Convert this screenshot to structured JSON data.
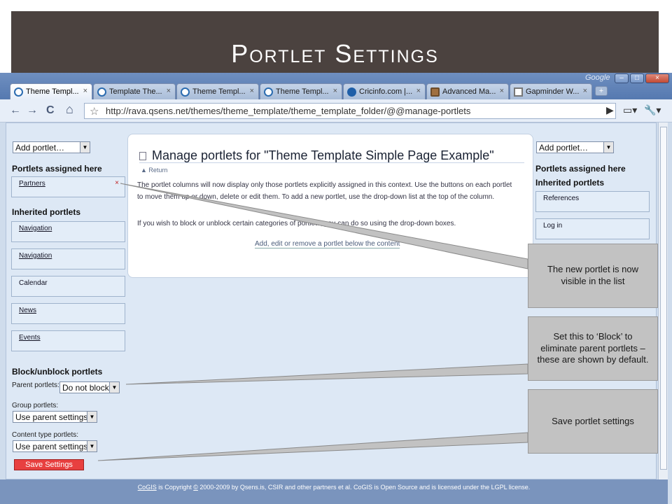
{
  "slide": {
    "title": "Portlet Settings"
  },
  "browser": {
    "google_label": "Google",
    "window_controls": {
      "minimize": "–",
      "maximize": "□",
      "close": "×"
    },
    "tabs": [
      {
        "label": "Theme Templ...",
        "close": "×",
        "icon": "site-icon",
        "active": true
      },
      {
        "label": "Template The...",
        "close": "×",
        "icon": "site-icon",
        "active": false
      },
      {
        "label": "Theme Templ...",
        "close": "×",
        "icon": "site-icon",
        "active": false
      },
      {
        "label": "Theme Templ...",
        "close": "×",
        "icon": "site-icon",
        "active": false
      },
      {
        "label": "Cricinfo.com |...",
        "close": "×",
        "icon": "cricinfo-icon",
        "active": false
      },
      {
        "label": "Advanced Ma...",
        "close": "×",
        "icon": "advanced-icon",
        "active": false
      },
      {
        "label": "Gapminder W...",
        "close": "×",
        "icon": "page-icon",
        "active": false
      }
    ],
    "new_tab": "+",
    "nav": {
      "back": "←",
      "forward": "→",
      "reload": "C",
      "home": "⌂",
      "star": "☆"
    },
    "url": "http://rava.qsens.net/themes/theme_template/theme_template_folder/@@manage-portlets",
    "right_icons": {
      "go": "▶",
      "page": "▭▾",
      "tools": "🔧▾"
    }
  },
  "left_column": {
    "add_portlet": "Add portlet…",
    "assigned_heading": "Portlets assigned here",
    "assigned": [
      {
        "label": "Partners",
        "delete": "×"
      }
    ],
    "inherited_heading": "Inherited portlets",
    "inherited": [
      {
        "label": "Navigation"
      },
      {
        "label": "Navigation"
      },
      {
        "label": "Calendar"
      },
      {
        "label": "News"
      },
      {
        "label": "Events"
      }
    ],
    "block_heading": "Block/unblock portlets",
    "parent_label": "Parent portlets:",
    "parent_value": "Do not block",
    "group_label": "Group portlets:",
    "group_value": "Use parent settings",
    "content_label": "Content type portlets:",
    "content_value": "Use parent settings",
    "save_label": "Save Settings"
  },
  "main": {
    "title": "Manage portlets for \"Theme Template Simple Page Example\"",
    "return_label": "▲ Return",
    "para1": "The portlet columns will now display only those portlets explicitly assigned in this context. Use the buttons on each portlet to move them up or down, delete or edit them. To add a new portlet, use the drop-down list at the top of the column.",
    "para2": "If you wish to block or unblock certain categories of portlets, you can do so using the drop-down boxes.",
    "link": "Add, edit or remove a portlet below the content"
  },
  "right_column": {
    "add_portlet": "Add portlet…",
    "assigned_heading": "Portlets assigned here",
    "inherited_heading": "Inherited portlets",
    "inherited": [
      {
        "label": "References"
      },
      {
        "label": "Log in"
      }
    ]
  },
  "footer": {
    "cogis": "CoGIS",
    "is_copyright": " is Copyright ",
    "copy_symbol": "©",
    "rest": " 2000-2009 by Qsens.is, CSIR and other partners et al. CoGIS is Open Source and is licensed under the LGPL license."
  },
  "callouts": [
    {
      "text": "The new portlet is now visible in the list"
    },
    {
      "text": "Set this to ‘Block’ to eliminate parent portlets – these are shown by default."
    },
    {
      "text": "Save portlet settings"
    }
  ]
}
